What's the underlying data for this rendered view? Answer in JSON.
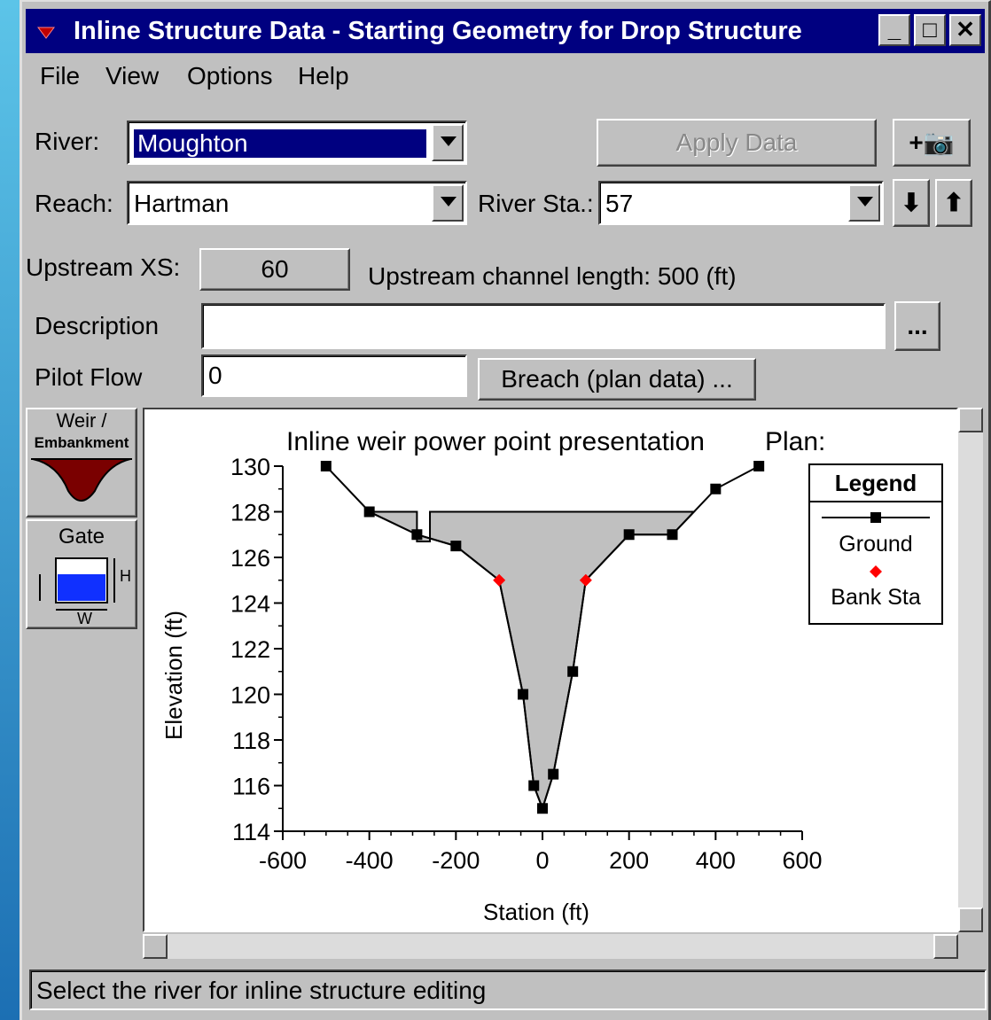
{
  "window": {
    "title": "Inline Structure Data - Starting Geometry for Drop Structure",
    "controls": [
      "_",
      "□",
      "✕"
    ]
  },
  "menu": {
    "file": "File",
    "view": "View",
    "options": "Options",
    "help": "Help"
  },
  "form": {
    "river_label": "River:",
    "river_value": "Moughton",
    "reach_label": "Reach:",
    "reach_value": "Hartman",
    "river_sta_label": "River Sta.:",
    "river_sta_value": "57",
    "apply_button": "Apply Data",
    "add_photo_button": "+📷",
    "down_arrow": "⬇",
    "up_arrow": "⬆",
    "upstream_xs_label": "Upstream XS:",
    "upstream_xs_value": "60",
    "upstream_length": "Upstream channel length: 500 (ft)",
    "description_label": "Description",
    "description_value": "",
    "ellipsis_button": "...",
    "pilot_flow_label": "Pilot Flow",
    "pilot_flow_value": "0",
    "breach_button": "Breach (plan data) ..."
  },
  "side_tools": {
    "weir_label_1": "Weir /",
    "weir_label_2": "Embankment",
    "gate_label": "Gate",
    "gate_h": "H",
    "gate_w": "W"
  },
  "status": "Select the river for inline structure editing",
  "colors": {
    "title_bg": "#000080",
    "ground": "#000000",
    "bank": "#ff0000",
    "fill": "#c0c0c0"
  },
  "chart_data": {
    "type": "line",
    "title": "Inline weir power point presentation",
    "plan_label": "Plan:",
    "xlabel": "Station (ft)",
    "ylabel": "Elevation (ft)",
    "xlim": [
      -600,
      600
    ],
    "ylim": [
      114,
      130
    ],
    "xticks": [
      "-600",
      "-400",
      "-200",
      "0",
      "200",
      "400",
      "600"
    ],
    "yticks": [
      "114",
      "116",
      "118",
      "120",
      "122",
      "124",
      "126",
      "128",
      "130"
    ],
    "legend_title": "Legend",
    "series": [
      {
        "name": "Ground",
        "x": [
          -500,
          -400,
          -290,
          -200,
          -100,
          -45,
          -20,
          0,
          25,
          70,
          100,
          200,
          300,
          400,
          500
        ],
        "y": [
          130,
          128,
          127,
          126.5,
          125,
          120,
          116,
          115,
          116.5,
          121,
          125,
          127,
          127,
          129,
          130
        ]
      },
      {
        "name": "Bank Sta",
        "x": [
          -100,
          100
        ],
        "y": [
          125,
          125
        ]
      }
    ],
    "weir_fill": {
      "x": [
        -400,
        -290,
        -290,
        -260,
        -260,
        350,
        300,
        200,
        100,
        70,
        25,
        0,
        -20,
        -45,
        -100,
        -200,
        -290,
        -400
      ],
      "y": [
        128,
        128,
        126.7,
        126.7,
        128,
        128,
        127,
        127,
        125,
        121,
        116.5,
        115,
        116,
        120,
        125,
        126.5,
        127,
        128
      ]
    }
  }
}
